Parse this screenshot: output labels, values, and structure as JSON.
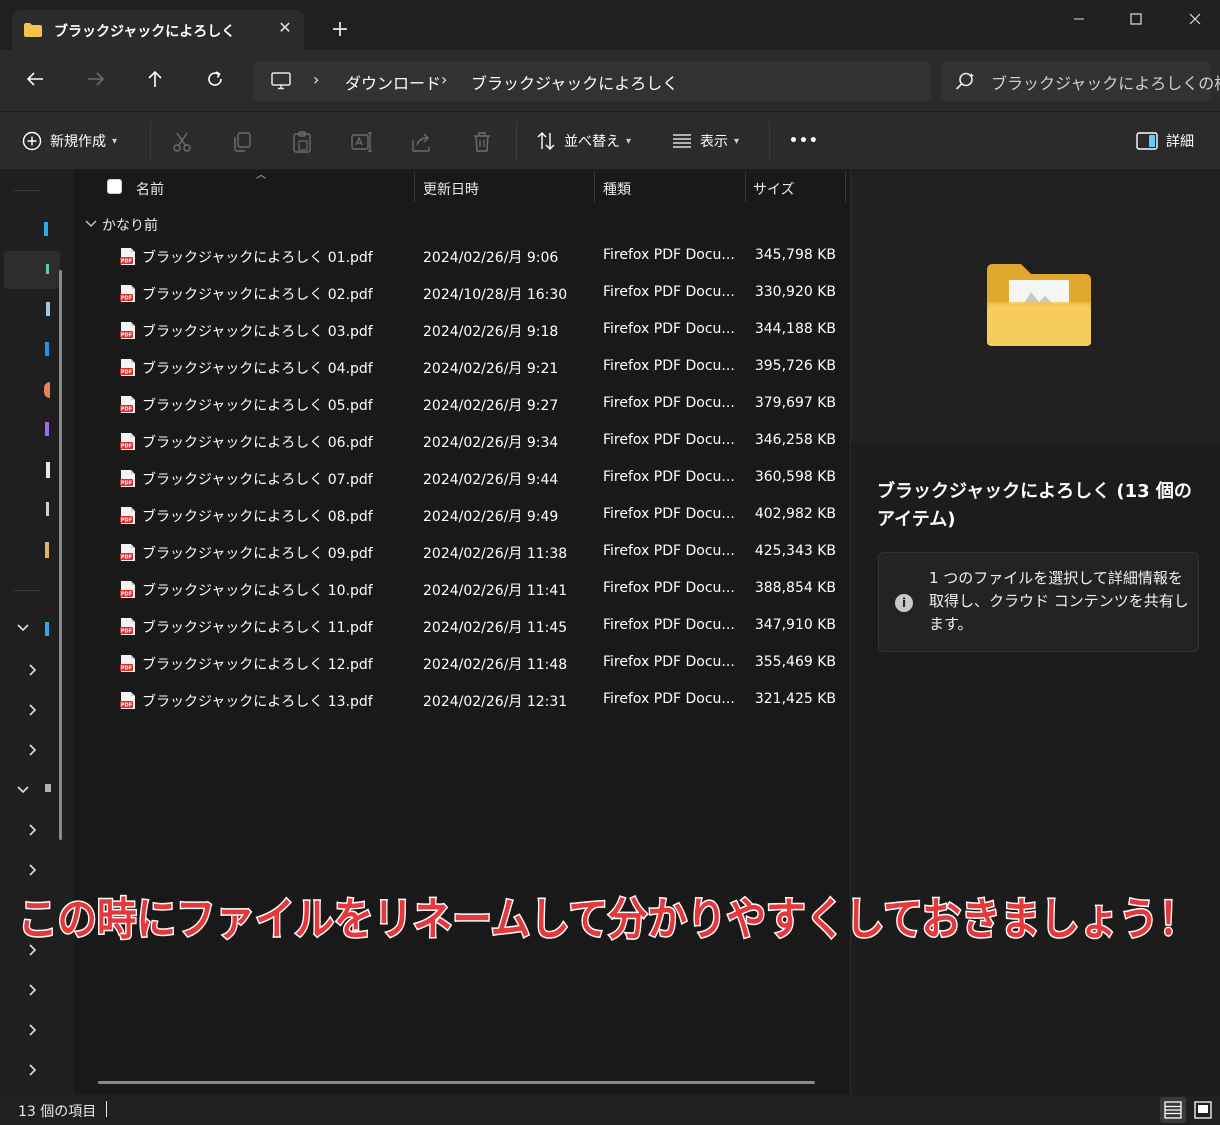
{
  "window": {
    "tab_title": "ブラックジャックによろしく",
    "tab_close": "✕",
    "new_tab": "+"
  },
  "address": {
    "crumbs": [
      "ダウンロード",
      "ブラックジャックによろしく"
    ],
    "search_placeholder": "ブラックジャックによろしくの検索"
  },
  "toolbar": {
    "new_label": "新規作成",
    "sort_label": "並べ替え",
    "view_label": "表示",
    "more_label": "•••",
    "details_label": "詳細"
  },
  "columns": {
    "name": "名前",
    "date": "更新日時",
    "type": "種類",
    "size": "サイズ"
  },
  "group": {
    "label": "かなり前"
  },
  "files": [
    {
      "name": "ブラックジャックによろしく 01.pdf",
      "date": "2024/02/26/月 9:06",
      "type": "Firefox PDF Docu...",
      "size": "345,798 KB"
    },
    {
      "name": "ブラックジャックによろしく 02.pdf",
      "date": "2024/10/28/月 16:30",
      "type": "Firefox PDF Docu...",
      "size": "330,920 KB"
    },
    {
      "name": "ブラックジャックによろしく 03.pdf",
      "date": "2024/02/26/月 9:18",
      "type": "Firefox PDF Docu...",
      "size": "344,188 KB"
    },
    {
      "name": "ブラックジャックによろしく 04.pdf",
      "date": "2024/02/26/月 9:21",
      "type": "Firefox PDF Docu...",
      "size": "395,726 KB"
    },
    {
      "name": "ブラックジャックによろしく 05.pdf",
      "date": "2024/02/26/月 9:27",
      "type": "Firefox PDF Docu...",
      "size": "379,697 KB"
    },
    {
      "name": "ブラックジャックによろしく 06.pdf",
      "date": "2024/02/26/月 9:34",
      "type": "Firefox PDF Docu...",
      "size": "346,258 KB"
    },
    {
      "name": "ブラックジャックによろしく 07.pdf",
      "date": "2024/02/26/月 9:44",
      "type": "Firefox PDF Docu...",
      "size": "360,598 KB"
    },
    {
      "name": "ブラックジャックによろしく 08.pdf",
      "date": "2024/02/26/月 9:49",
      "type": "Firefox PDF Docu...",
      "size": "402,982 KB"
    },
    {
      "name": "ブラックジャックによろしく 09.pdf",
      "date": "2024/02/26/月 11:38",
      "type": "Firefox PDF Docu...",
      "size": "425,343 KB"
    },
    {
      "name": "ブラックジャックによろしく 10.pdf",
      "date": "2024/02/26/月 11:41",
      "type": "Firefox PDF Docu...",
      "size": "388,854 KB"
    },
    {
      "name": "ブラックジャックによろしく 11.pdf",
      "date": "2024/02/26/月 11:45",
      "type": "Firefox PDF Docu...",
      "size": "347,910 KB"
    },
    {
      "name": "ブラックジャックによろしく 12.pdf",
      "date": "2024/02/26/月 11:48",
      "type": "Firefox PDF Docu...",
      "size": "355,469 KB"
    },
    {
      "name": "ブラックジャックによろしく 13.pdf",
      "date": "2024/02/26/月 12:31",
      "type": "Firefox PDF Docu...",
      "size": "321,425 KB"
    }
  ],
  "details": {
    "title": "ブラックジャックによろしく (13 個のアイテム)",
    "info_text": "1 つのファイルを選択して詳細情報を取得し、クラウド コンテンツを共有します。",
    "info_icon": "i"
  },
  "status": {
    "item_count": "13 個の項目"
  },
  "caption": {
    "text": "この時にファイルをリネームして分かりやすくしておきましょう！"
  },
  "colors": {
    "accent": "#60cdff",
    "folder": "#f3c34c",
    "pdf_red": "#d9302c",
    "caption_fill": "#e5383b"
  }
}
